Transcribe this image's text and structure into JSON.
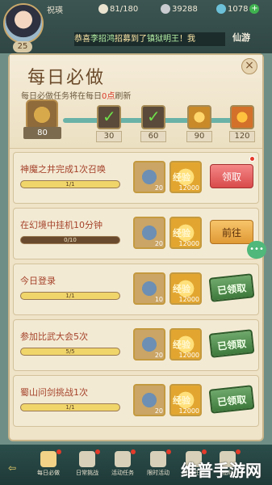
{
  "player": {
    "name": "祝瑛",
    "level": "25"
  },
  "resources": [
    {
      "icon": "silver-ingot-icon",
      "value": "81/180",
      "color": "#e9e3cf"
    },
    {
      "icon": "coin-icon",
      "value": "39288",
      "color": "#c9cbd0"
    },
    {
      "icon": "jade-icon",
      "value": "1078",
      "color": "#6cc1d8"
    }
  ],
  "chat": {
    "part1": "恭喜",
    "name1": "李招鸿",
    "part2": "招募到了",
    "name2": "镇狱明王",
    "part3": "！我"
  },
  "xianyou": "仙游",
  "daily": {
    "title": "每日必做",
    "subtitle_a": "每日必做任务将在每日",
    "subtitle_time": "0点",
    "subtitle_b": "刷新",
    "score": "80",
    "milestones": [
      "30",
      "60",
      "90",
      "120"
    ]
  },
  "tasks": [
    {
      "title": "神魔之井完成1次召唤",
      "progress": "1/1",
      "progress_value": 1.0,
      "item_count": "20",
      "exp_label": "经验",
      "exp_count": "12000",
      "action": "领取",
      "state": "claim"
    },
    {
      "title": "在幻境中挂机10分钟",
      "progress": "0/10",
      "progress_value": 0.0,
      "item_count": "20",
      "exp_label": "经验",
      "exp_count": "12000",
      "action": "前往",
      "state": "goto"
    },
    {
      "title": "今日登录",
      "progress": "1/1",
      "progress_value": 1.0,
      "item_count": "10",
      "exp_label": "经验",
      "exp_count": "12000",
      "action": "已领取",
      "state": "done"
    },
    {
      "title": "参加比武大会5次",
      "progress": "5/5",
      "progress_value": 1.0,
      "item_count": "20",
      "exp_label": "经验",
      "exp_count": "12000",
      "action": "已领取",
      "state": "done"
    },
    {
      "title": "蜀山问剑挑战1次",
      "progress": "1/1",
      "progress_value": 1.0,
      "item_count": "20",
      "exp_label": "经验",
      "exp_count": "12000",
      "action": "已领取",
      "state": "done"
    }
  ],
  "chat_bubble": "•••",
  "nav": [
    {
      "label": "每日必做",
      "icon": "scroll-icon"
    },
    {
      "label": "日常挑战",
      "icon": "sword-icon"
    },
    {
      "label": "活动任务",
      "icon": "flag-icon"
    },
    {
      "label": "限时活动",
      "icon": "clock-icon"
    },
    {
      "label": "成就任务",
      "icon": "trophy-icon"
    },
    {
      "label": "福利",
      "icon": "gift-icon"
    }
  ],
  "watermark": "维普手游网"
}
